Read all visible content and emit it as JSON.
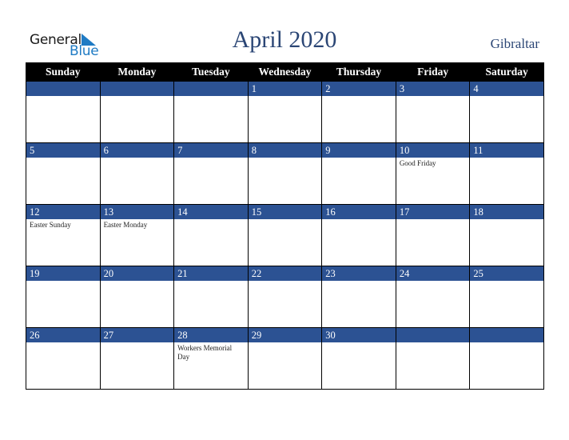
{
  "logo": {
    "line1": "General",
    "line2": "Blue",
    "colors": {
      "text": "#1a1a1a",
      "accent": "#1f7bc4"
    }
  },
  "title": "April 2020",
  "country": "Gibraltar",
  "colors": {
    "header_bg": "#000000",
    "day_bar": "#2c5293",
    "title": "#2b4675"
  },
  "weekdays": [
    "Sunday",
    "Monday",
    "Tuesday",
    "Wednesday",
    "Thursday",
    "Friday",
    "Saturday"
  ],
  "weeks": [
    [
      {
        "day": "",
        "event": ""
      },
      {
        "day": "",
        "event": ""
      },
      {
        "day": "",
        "event": ""
      },
      {
        "day": "1",
        "event": ""
      },
      {
        "day": "2",
        "event": ""
      },
      {
        "day": "3",
        "event": ""
      },
      {
        "day": "4",
        "event": ""
      }
    ],
    [
      {
        "day": "5",
        "event": ""
      },
      {
        "day": "6",
        "event": ""
      },
      {
        "day": "7",
        "event": ""
      },
      {
        "day": "8",
        "event": ""
      },
      {
        "day": "9",
        "event": ""
      },
      {
        "day": "10",
        "event": "Good Friday"
      },
      {
        "day": "11",
        "event": ""
      }
    ],
    [
      {
        "day": "12",
        "event": "Easter Sunday"
      },
      {
        "day": "13",
        "event": "Easter Monday"
      },
      {
        "day": "14",
        "event": ""
      },
      {
        "day": "15",
        "event": ""
      },
      {
        "day": "16",
        "event": ""
      },
      {
        "day": "17",
        "event": ""
      },
      {
        "day": "18",
        "event": ""
      }
    ],
    [
      {
        "day": "19",
        "event": ""
      },
      {
        "day": "20",
        "event": ""
      },
      {
        "day": "21",
        "event": ""
      },
      {
        "day": "22",
        "event": ""
      },
      {
        "day": "23",
        "event": ""
      },
      {
        "day": "24",
        "event": ""
      },
      {
        "day": "25",
        "event": ""
      }
    ],
    [
      {
        "day": "26",
        "event": ""
      },
      {
        "day": "27",
        "event": ""
      },
      {
        "day": "28",
        "event": "Workers Memorial Day"
      },
      {
        "day": "29",
        "event": ""
      },
      {
        "day": "30",
        "event": ""
      },
      {
        "day": "",
        "event": ""
      },
      {
        "day": "",
        "event": ""
      }
    ]
  ]
}
